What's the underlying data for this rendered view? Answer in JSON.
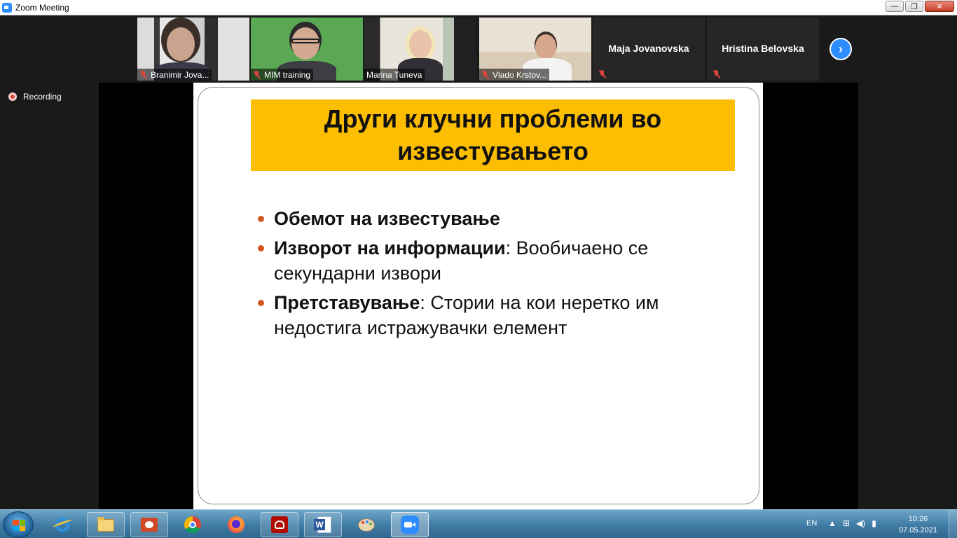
{
  "window": {
    "title": "Zoom Meeting",
    "controls": {
      "minimize": "—",
      "restore": "❐",
      "close": "✕"
    }
  },
  "participants": [
    {
      "name": "Branimir Jova...",
      "muted": true,
      "video": true
    },
    {
      "name": "MIM training",
      "muted": true,
      "video": true
    },
    {
      "name": "Marina Tuneva",
      "muted": false,
      "video": true,
      "active_speaker": true
    },
    {
      "name": "Vlado Krstov...",
      "muted": true,
      "video": true
    },
    {
      "name": "Maja Jovanovska",
      "muted": true,
      "video": false
    },
    {
      "name": "Hristina Belovska",
      "muted": true,
      "video": false
    }
  ],
  "next_page_icon": "›",
  "recording": {
    "label": "Recording"
  },
  "slide": {
    "title": "Други клучни проблеми во известувањето",
    "bullets": [
      {
        "bold": "Обемот на известување",
        "rest": ""
      },
      {
        "bold": "Изворот на информации",
        "rest": ": Вообичаено се секундарни извори"
      },
      {
        "bold": "Претставување",
        "rest": ": Стории на кои неретко им недостига истражувачки елемент"
      }
    ]
  },
  "taskbar": {
    "apps": [
      "internet-explorer",
      "file-explorer",
      "presentation-app",
      "chrome",
      "firefox",
      "acrobat-reader",
      "word",
      "paint",
      "zoom"
    ],
    "language": "EN",
    "time": "10:26",
    "date": "07.05.2021"
  },
  "colors": {
    "title_banner": "#fdbd01",
    "bullet": "#d2571f",
    "active_speaker_border": "#7fc242",
    "zoom_blue": "#2d8cff",
    "mute_red": "#e0443e"
  }
}
